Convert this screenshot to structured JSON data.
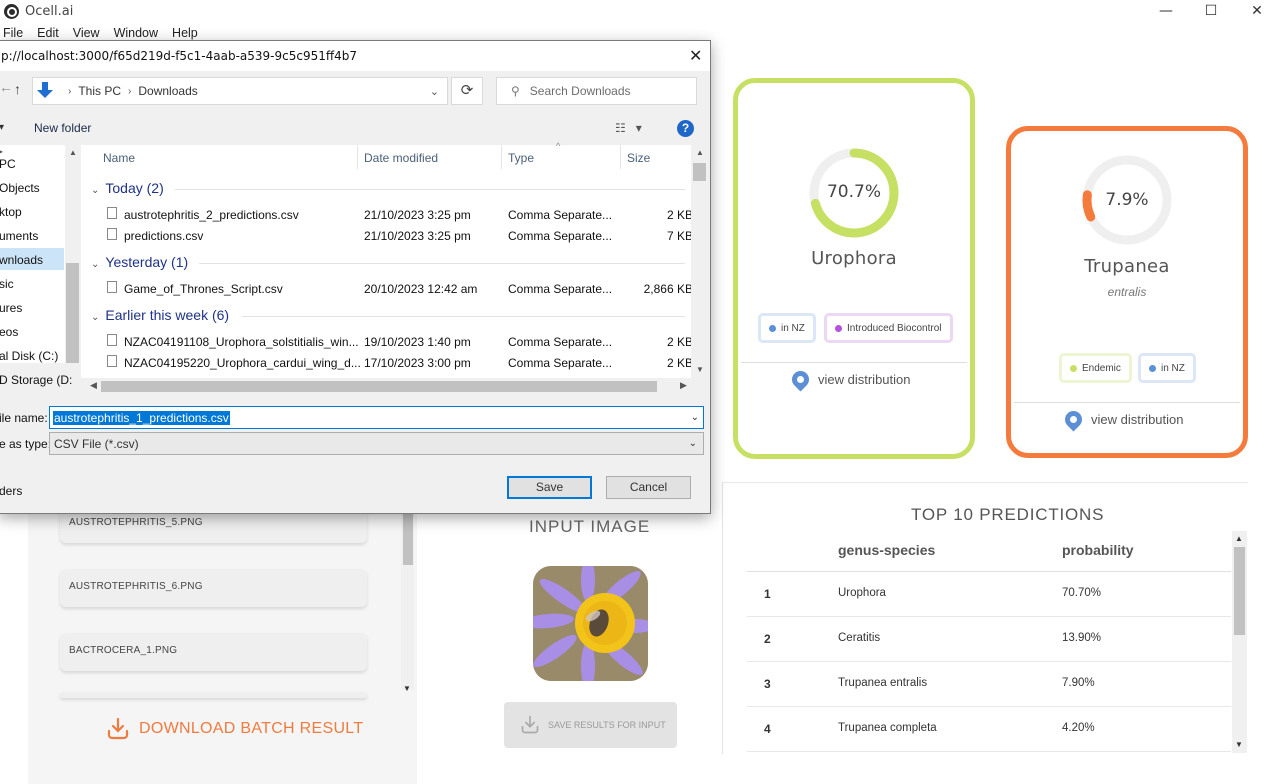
{
  "app": {
    "title": "Ocell.ai",
    "minimize": "—",
    "maximize": "☐",
    "close": "✕",
    "menu": [
      "File",
      "Edit",
      "View",
      "Window",
      "Help"
    ]
  },
  "dialog": {
    "title": "p://localhost:3000/f65d219d-f5c1-4aab-a539-9c5c951ff4b7",
    "close": "✕",
    "breadcrumb": [
      "This PC",
      "Downloads"
    ],
    "search_placeholder": "Search Downloads",
    "new_folder": "New folder",
    "help": "?",
    "nav_items": [
      "PC",
      "Objects",
      "ktop",
      "uments",
      "wnloads",
      "sic",
      "ures",
      "eos",
      "al Disk (C:)",
      "D Storage (D:"
    ],
    "columns": [
      "Name",
      "Date modified",
      "Type",
      "Size"
    ],
    "groups": [
      {
        "label": "Today (2)",
        "files": [
          {
            "name": "austrotephritis_2_predictions.csv",
            "date": "21/10/2023 3:25 pm",
            "type": "Comma Separate...",
            "size": "2 KB"
          },
          {
            "name": "predictions.csv",
            "date": "21/10/2023 3:25 pm",
            "type": "Comma Separate...",
            "size": "7 KB"
          }
        ]
      },
      {
        "label": "Yesterday (1)",
        "files": [
          {
            "name": "Game_of_Thrones_Script.csv",
            "date": "20/10/2023 12:42 am",
            "type": "Comma Separate...",
            "size": "2,866 KB"
          }
        ]
      },
      {
        "label": "Earlier this week (6)",
        "files": [
          {
            "name": "NZAC04191108_Urophora_solstitialis_win...",
            "date": "19/10/2023 1:40 pm",
            "type": "Comma Separate...",
            "size": "2 KB"
          },
          {
            "name": "NZAC04195220_Urophora_cardui_wing_d...",
            "date": "17/10/2023 3:00 pm",
            "type": "Comma Separate...",
            "size": "2 KB"
          }
        ]
      }
    ],
    "file_name_label": "ile name:",
    "file_name_value": "austrotephritis_1_predictions.csv",
    "save_type_label": "e as type:",
    "save_type_value": "CSV File (*.csv)",
    "hide_folders": "ders",
    "save": "Save",
    "cancel": "Cancel"
  },
  "cards": [
    {
      "species": "Urophora",
      "epithet": "",
      "percent_label": "70.7%",
      "percent": 70.7,
      "accent": "#c5e063",
      "tags": [
        {
          "label": "in NZ",
          "dot": "#5b8fd8",
          "border": "#dbe6f7"
        },
        {
          "label": "Introduced Biocontrol",
          "dot": "#b550e0",
          "border": "#ecd7f5"
        }
      ],
      "view": "view distribution"
    },
    {
      "species": "Trupanea",
      "epithet": "entralis",
      "percent_label": "7.9%",
      "percent": 7.9,
      "accent": "#f47b3b",
      "tags": [
        {
          "label": "Endemic",
          "dot": "#c5e063",
          "border": "#eef5d5"
        },
        {
          "label": "in NZ",
          "dot": "#5b8fd8",
          "border": "#dbe6f7"
        }
      ],
      "view": "view distribution"
    }
  ],
  "batch": {
    "items": [
      "AUSTROTEPHRITIS_5.PNG",
      "AUSTROTEPHRITIS_6.PNG",
      "BACTROCERA_1.PNG"
    ],
    "download": "DOWNLOAD BATCH RESULT"
  },
  "input": {
    "label": "INPUT IMAGE",
    "save": "SAVE RESULTS FOR INPUT"
  },
  "top10": {
    "title": "TOP 10 PREDICTIONS",
    "headers": [
      "genus-species",
      "probability"
    ],
    "rows": [
      {
        "rank": "1",
        "name": "Urophora",
        "prob": "70.70%"
      },
      {
        "rank": "2",
        "name": "Ceratitis",
        "prob": "13.90%"
      },
      {
        "rank": "3",
        "name": "Trupanea entralis",
        "prob": "7.90%"
      },
      {
        "rank": "4",
        "name": "Trupanea completa",
        "prob": "4.20%"
      }
    ]
  }
}
